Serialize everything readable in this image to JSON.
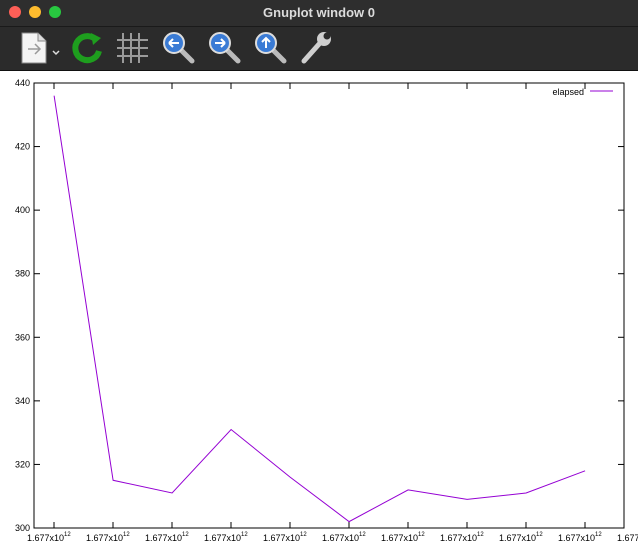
{
  "window": {
    "title": "Gnuplot window 0"
  },
  "toolbar": {
    "items": [
      "export-button",
      "replot-button",
      "grid-toggle-button",
      "zoom-previous-button",
      "zoom-next-button",
      "unzoom-button",
      "settings-button"
    ]
  },
  "chart_data": {
    "type": "line",
    "x_tick_base": "1.677x10",
    "x_tick_exponent": "12",
    "x_tick_count": 11,
    "y_ticks": [
      "300",
      "320",
      "340",
      "360",
      "380",
      "400",
      "420",
      "440"
    ],
    "ylim": [
      300,
      440
    ],
    "grid": false,
    "legend_position": "top-right",
    "series": [
      {
        "name": "elapsed",
        "color": "#9400d3",
        "x_index": [
          0.12,
          1.12,
          2.12,
          3.12,
          4.12,
          5.12,
          6.12,
          7.12,
          8.12,
          9.12
        ],
        "values": [
          436,
          315,
          311,
          331,
          316,
          302,
          312,
          309,
          311,
          318
        ]
      }
    ]
  }
}
